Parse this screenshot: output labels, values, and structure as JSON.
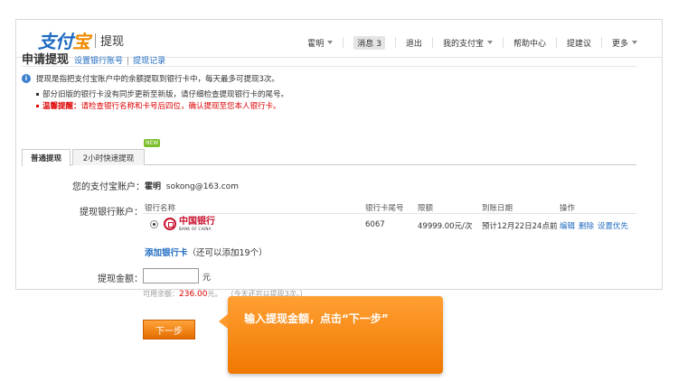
{
  "header": {
    "logo_main": "支付",
    "logo_accent": "宝",
    "logo_sub": "提现",
    "nav": {
      "user": "霍明",
      "messages_label": "消息",
      "messages_count": "3",
      "logout": "退出",
      "my_alipay": "我的支付宝",
      "help": "帮助中心",
      "suggest": "提建议",
      "more": "更多"
    }
  },
  "page": {
    "title": "申请提现",
    "link_set_account": "设置银行账号",
    "link_history": "提现记录",
    "link_sep": "|"
  },
  "notes": {
    "info": "提现是指把支付宝账户中的余额提取到银行卡中，每天最多可提现3次。",
    "bullet1": "部分旧版的银行卡没有同步更新至新版，请仔细检查提现银行卡的尾号。",
    "warn_label": "温馨提醒：",
    "warn_text": "请检查银行名称和卡号后四位，确认提现至您本人银行卡。"
  },
  "tabs": [
    {
      "label": "普通提现"
    },
    {
      "label": "2小时快速提现"
    }
  ],
  "tab_badge": "NEW",
  "form": {
    "account_label": "您的支付宝账户：",
    "account_name": "霍明",
    "account_email": "sokong@163.com",
    "bank_label": "提现银行账户：",
    "columns": {
      "bank_name": "银行名称",
      "card_tail": "银行卡尾号",
      "limit": "限额",
      "arrival": "到账日期",
      "action": "操作"
    },
    "bank": {
      "name_cn": "中国银行",
      "name_en": "BANK OF CHINA",
      "card_tail": "6067",
      "limit": "49999.00元/次",
      "arrival": "预计12月22日24点前",
      "action_edit": "编辑",
      "action_delete": "删除",
      "action_default": "设置优先"
    },
    "add_card_link": "添加银行卡",
    "add_card_note": "（还可以添加19个）",
    "amount_label": "提现金额：",
    "amount_value": "",
    "unit": "元",
    "avail_prefix": "可用余额：",
    "avail_amount": "236.00",
    "avail_unit": "元。",
    "avail_note": "（今天还可以提现3次。）",
    "next_button": "下一步"
  },
  "callout": {
    "text": "输入提现金额，点击“下一步”"
  },
  "colors": {
    "brand_blue": "#1f6bc1",
    "accent_orange": "#f08a00",
    "warn_red": "#dd0000"
  }
}
